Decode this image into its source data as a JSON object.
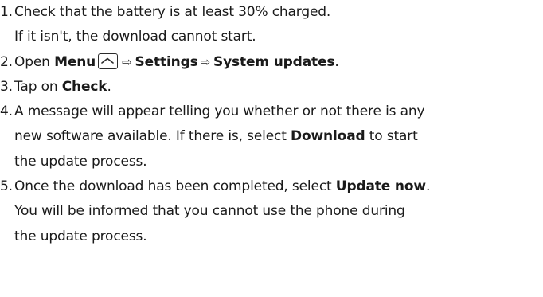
{
  "steps": [
    {
      "number": "1.",
      "lines": [
        "Check that the battery is at least 30% charged.",
        "If it isn't, the download cannot start."
      ]
    },
    {
      "number": "2.",
      "pre": "Open ",
      "menu": "Menu",
      "menu_key_icon": "menu-key-icon",
      "arrow": "⇨",
      "settings": "Settings",
      "system_updates": "System updates",
      "end": "."
    },
    {
      "number": "3.",
      "pre": "Tap on ",
      "bold": "Check",
      "end": "."
    },
    {
      "number": "4.",
      "line1": "A message will appear telling you whether or not there is any",
      "line2_pre": "new software available. If there is, select ",
      "line2_bold": "Download",
      "line2_post": " to start",
      "line3": "the update process."
    },
    {
      "number": "5.",
      "line1_pre": "Once the download has been completed, select ",
      "line1_bold": "Update now",
      "line1_post": ".",
      "line2": "You will be informed that you cannot use the phone during",
      "line3": "the update process."
    }
  ]
}
